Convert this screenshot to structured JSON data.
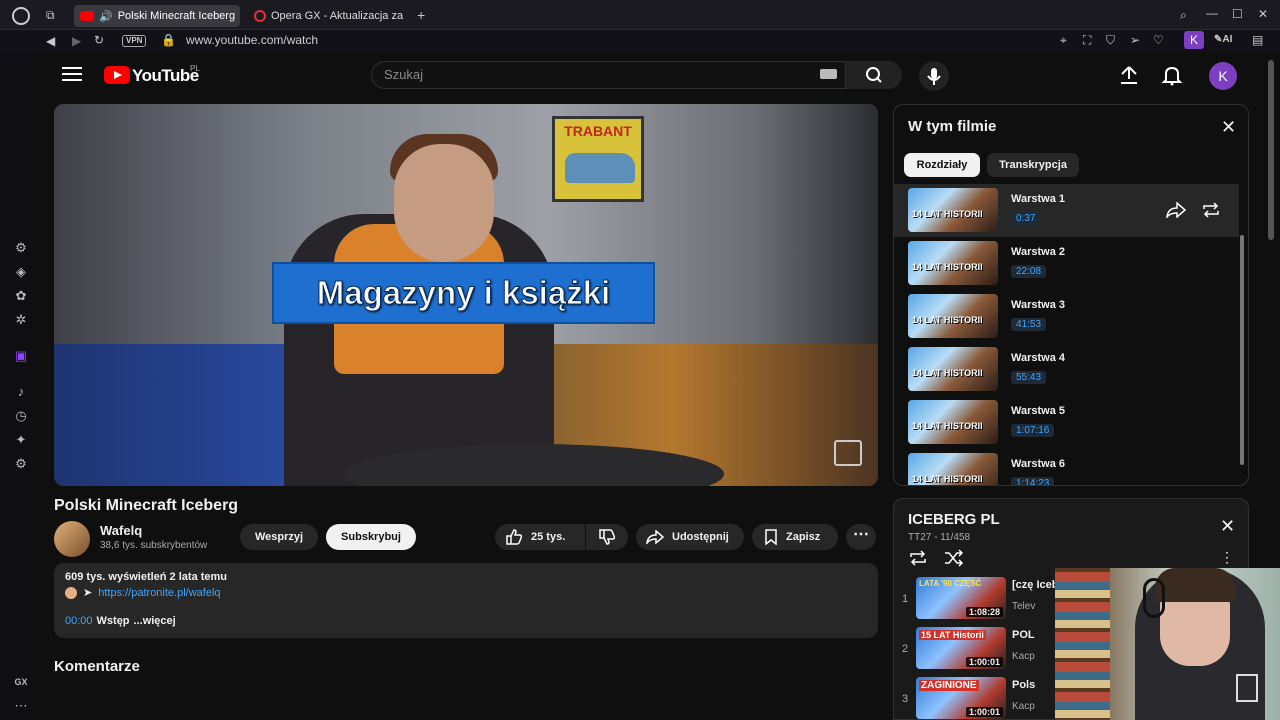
{
  "browser": {
    "tabs": [
      {
        "title": "Polski Minecraft Iceberg",
        "active": true
      },
      {
        "title": "Opera GX - Aktualizacja za",
        "active": false
      }
    ],
    "url": "www.youtube.com/watch",
    "vpn_label": "VPN",
    "ai_label": "AI",
    "profile_initial": "K",
    "gx_label": "GX"
  },
  "header": {
    "logo_text": "YouTube",
    "region": "PL",
    "search_placeholder": "Szukaj",
    "avatar_initial": "K"
  },
  "video": {
    "caption": "Magazyny i książki",
    "poster_text": "TRABANT",
    "title": "Polski Minecraft Iceberg",
    "channel": "Wafelq",
    "subscribers": "38,6 tys. subskrybentów",
    "support_label": "Wesprzyj",
    "subscribe_label": "Subskrybuj",
    "likes": "25 tys.",
    "share_label": "Udostępnij",
    "save_label": "Zapisz",
    "views_line": "609 tys. wyświetleń  2 lata temu",
    "link": "https://patronite.pl/wafelq",
    "chapter_time": "00:00",
    "chapter_text": "Wstęp",
    "more_label": "...więcej",
    "comments_heading": "Komentarze"
  },
  "chapters_panel": {
    "heading": "W tym filmie",
    "tabs": [
      "Rozdziały",
      "Transkrypcja"
    ],
    "thumb_text": "14 LAT HISTORII",
    "items": [
      {
        "title": "Warstwa 1",
        "time": "0:37"
      },
      {
        "title": "Warstwa 2",
        "time": "22:08"
      },
      {
        "title": "Warstwa 3",
        "time": "41:53"
      },
      {
        "title": "Warstwa 4",
        "time": "55:43"
      },
      {
        "title": "Warstwa 5",
        "time": "1:07:16"
      },
      {
        "title": "Warstwa 6",
        "time": "1:14:23"
      }
    ]
  },
  "playlist": {
    "title": "ICEBERG PL",
    "subtitle": "TT27 - 11/458",
    "items": [
      {
        "index": "1",
        "name": "[czę Iceb",
        "channel": "Telev",
        "duration": "1:08:28",
        "thumb_text": "LATA '90 CZĘŚĆ"
      },
      {
        "index": "2",
        "name": "POL",
        "channel": "Kacp",
        "duration": "1:00:01",
        "thumb_text": "15 LAT Historii"
      },
      {
        "index": "3",
        "name": "Pols",
        "channel": "Kacp",
        "duration": "1:00:01",
        "thumb_text": "ZAGINIONE"
      }
    ]
  },
  "colors": {
    "accent_red": "#ff0000",
    "link_blue": "#3ea6ff",
    "avatar_purple": "#7b3fbf"
  }
}
